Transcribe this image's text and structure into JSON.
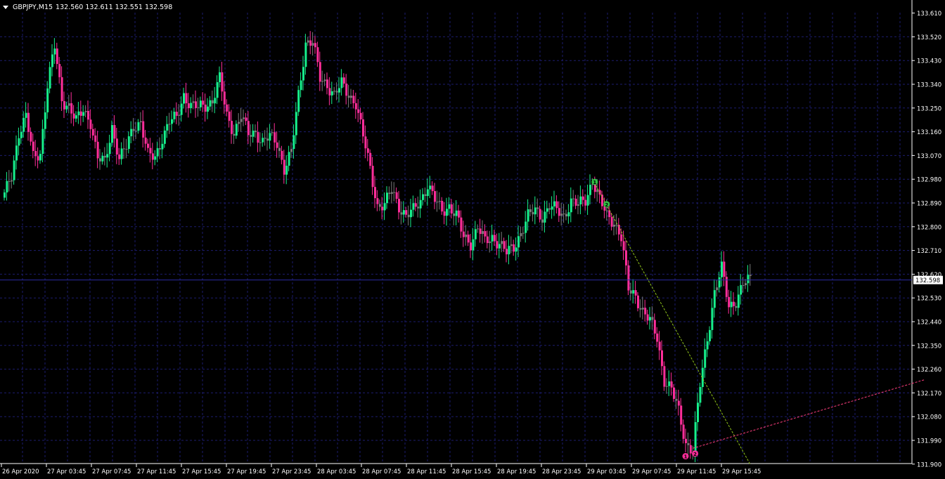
{
  "header": {
    "symbol_tf": "GBPJPY,M15",
    "ohlc": "132.560 132.611 132.551 132.598"
  },
  "colors": {
    "background": "#000000",
    "grid": "#1c1c6e",
    "axis": "#ffffff",
    "bull": "#16f08c",
    "bear": "#ff2e9a",
    "neutral": "#7a7a7a",
    "price_line": "#2a2aa0",
    "zigzag_up": "#8ec21a",
    "zigzag_down": "#ff3f7f",
    "marker_green": "#2fc244",
    "marker_pink": "#ff2e9a"
  },
  "chart_data": {
    "type": "candlestick",
    "symbol": "GBPJPY",
    "timeframe": "M15",
    "y_ticks": [
      "133.610",
      "133.520",
      "133.430",
      "133.340",
      "133.250",
      "133.160",
      "133.070",
      "132.980",
      "132.890",
      "132.800",
      "132.710",
      "132.620",
      "132.530",
      "132.440",
      "132.350",
      "132.260",
      "132.170",
      "132.080",
      "131.990",
      "131.900"
    ],
    "ylim": [
      131.9,
      133.61
    ],
    "x_ticks": [
      "26 Apr 2020",
      "27 Apr 03:45",
      "27 Apr 07:45",
      "27 Apr 11:45",
      "27 Apr 15:45",
      "27 Apr 19:45",
      "27 Apr 23:45",
      "28 Apr 03:45",
      "28 Apr 07:45",
      "28 Apr 11:45",
      "28 Apr 15:45",
      "28 Apr 19:45",
      "28 Apr 23:45",
      "29 Apr 03:45",
      "29 Apr 07:45",
      "29 Apr 11:45",
      "29 Apr 15:45"
    ],
    "current_price": "132.598",
    "grid": true,
    "anchors": [
      [
        0,
        132.92
      ],
      [
        3,
        132.99
      ],
      [
        6,
        133.16
      ],
      [
        9,
        133.22
      ],
      [
        12,
        133.06
      ],
      [
        15,
        133.08
      ],
      [
        18,
        133.34
      ],
      [
        21,
        133.48
      ],
      [
        24,
        133.28
      ],
      [
        27,
        133.26
      ],
      [
        30,
        133.2
      ],
      [
        33,
        133.24
      ],
      [
        36,
        133.2
      ],
      [
        39,
        133.06
      ],
      [
        42,
        133.04
      ],
      [
        45,
        133.18
      ],
      [
        48,
        133.06
      ],
      [
        51,
        133.1
      ],
      [
        54,
        133.18
      ],
      [
        57,
        133.2
      ],
      [
        60,
        133.07
      ],
      [
        63,
        133.06
      ],
      [
        66,
        133.14
      ],
      [
        69,
        133.2
      ],
      [
        72,
        133.21
      ],
      [
        75,
        133.3
      ],
      [
        78,
        133.26
      ],
      [
        81,
        133.25
      ],
      [
        84,
        133.26
      ],
      [
        87,
        133.28
      ],
      [
        90,
        133.36
      ],
      [
        93,
        133.22
      ],
      [
        96,
        133.16
      ],
      [
        99,
        133.22
      ],
      [
        102,
        133.15
      ],
      [
        105,
        133.16
      ],
      [
        108,
        133.12
      ],
      [
        111,
        133.14
      ],
      [
        114,
        133.12
      ],
      [
        117,
        133.02
      ],
      [
        120,
        133.08
      ],
      [
        123,
        133.3
      ],
      [
        126,
        133.5
      ],
      [
        129,
        133.5
      ],
      [
        132,
        133.36
      ],
      [
        135,
        133.34
      ],
      [
        138,
        133.3
      ],
      [
        141,
        133.34
      ],
      [
        144,
        133.3
      ],
      [
        147,
        133.27
      ],
      [
        150,
        133.14
      ],
      [
        153,
        133.02
      ],
      [
        156,
        132.88
      ],
      [
        159,
        132.88
      ],
      [
        162,
        132.94
      ],
      [
        165,
        132.88
      ],
      [
        168,
        132.84
      ],
      [
        171,
        132.86
      ],
      [
        174,
        132.9
      ],
      [
        177,
        132.96
      ],
      [
        180,
        132.9
      ],
      [
        183,
        132.86
      ],
      [
        186,
        132.88
      ],
      [
        189,
        132.84
      ],
      [
        192,
        132.76
      ],
      [
        195,
        132.74
      ],
      [
        198,
        132.8
      ],
      [
        201,
        132.74
      ],
      [
        204,
        132.76
      ],
      [
        207,
        132.74
      ],
      [
        210,
        132.7
      ],
      [
        213,
        132.72
      ],
      [
        216,
        132.78
      ],
      [
        219,
        132.84
      ],
      [
        222,
        132.86
      ],
      [
        225,
        132.84
      ],
      [
        228,
        132.88
      ],
      [
        231,
        132.86
      ],
      [
        234,
        132.84
      ],
      [
        237,
        132.9
      ],
      [
        240,
        132.88
      ],
      [
        243,
        132.9
      ],
      [
        246,
        132.98
      ],
      [
        249,
        132.9
      ],
      [
        252,
        132.84
      ],
      [
        255,
        132.82
      ],
      [
        258,
        132.76
      ],
      [
        261,
        132.56
      ],
      [
        264,
        132.54
      ],
      [
        267,
        132.48
      ],
      [
        270,
        132.44
      ],
      [
        273,
        132.38
      ],
      [
        276,
        132.22
      ],
      [
        279,
        132.18
      ],
      [
        282,
        132.1
      ],
      [
        285,
        131.98
      ],
      [
        288,
        131.95
      ],
      [
        291,
        132.2
      ],
      [
        294,
        132.38
      ],
      [
        297,
        132.55
      ],
      [
        300,
        132.64
      ],
      [
        303,
        132.5
      ],
      [
        306,
        132.52
      ],
      [
        309,
        132.58
      ],
      [
        312,
        132.6
      ]
    ],
    "zigzag": {
      "segments": [
        {
          "from": [
            246,
            132.98
          ],
          "to": [
            312,
            131.9
          ],
          "style": "dashed",
          "color": "zigzag_up"
        },
        {
          "from": [
            288,
            131.96
          ],
          "to": [
            385,
            132.22
          ],
          "style": "dashed",
          "color": "zigzag_down"
        }
      ],
      "markers": [
        {
          "pos": [
            247,
            132.97
          ],
          "label": "1",
          "color": "marker_green"
        },
        {
          "pos": [
            252,
            132.885
          ],
          "label": "2",
          "color": "marker_green"
        },
        {
          "pos": [
            285,
            131.93
          ],
          "label": "1",
          "color": "marker_pink"
        },
        {
          "pos": [
            289,
            131.94
          ],
          "label": "2",
          "color": "marker_pink"
        }
      ]
    }
  }
}
